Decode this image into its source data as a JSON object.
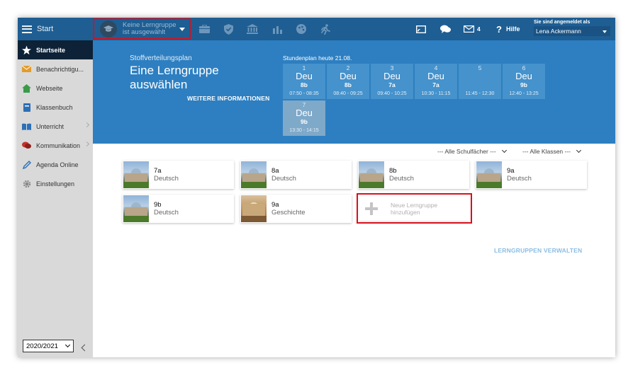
{
  "topbar": {
    "start_label": "Start",
    "group_select_line1": "Keine Lerngruppe",
    "group_select_line2": "ist ausgewählt",
    "icons": [
      "briefcase-icon",
      "shield-icon",
      "institution-icon",
      "bar-chart-icon",
      "palette-icon",
      "running-icon"
    ],
    "mail_count": "4",
    "help_label": "Hilfe",
    "login_label": "Sie sind angemeldet als",
    "login_user": "Lena Ackermann"
  },
  "sidebar": {
    "items": [
      {
        "label": "Startseite",
        "icon": "star-icon",
        "active": true
      },
      {
        "label": "Benachrichtigu...",
        "icon": "envelope-icon"
      },
      {
        "label": "Webseite",
        "icon": "home-icon"
      },
      {
        "label": "Klassenbuch",
        "icon": "book-icon"
      },
      {
        "label": "Unterricht",
        "icon": "open-book-icon",
        "chevron": true
      },
      {
        "label": "Kommunikation",
        "icon": "chat-icon",
        "chevron": true
      },
      {
        "label": "Agenda Online",
        "icon": "pencil-icon"
      },
      {
        "label": "Einstellungen",
        "icon": "gear-icon"
      }
    ],
    "year": "2020/2021"
  },
  "hero": {
    "subtitle": "Stoffverteilungsplan",
    "title": "Eine Lerngruppe auswählen",
    "more_link": "WEITERE INFORMATIONEN",
    "schedule_title": "Stundenplan heute 21.08.",
    "slots": [
      {
        "num": "1",
        "subject": "Deu",
        "class": "8b",
        "time": "07:50 - 08:35"
      },
      {
        "num": "2",
        "subject": "Deu",
        "class": "8b",
        "time": "08:40 - 09:25"
      },
      {
        "num": "3",
        "subject": "Deu",
        "class": "7a",
        "time": "09:40 - 10:25"
      },
      {
        "num": "4",
        "subject": "Deu",
        "class": "7a",
        "time": "10:30 - 11:15"
      },
      {
        "num": "5",
        "subject": "",
        "class": "",
        "time": "11:45 - 12:30"
      },
      {
        "num": "6",
        "subject": "Deu",
        "class": "9b",
        "time": "12:40 - 13:25"
      },
      {
        "num": "7",
        "subject": "Deu",
        "class": "9b",
        "time": "13:30 - 14:15"
      }
    ]
  },
  "filters": {
    "subjects": "--- Alle Schulfächer ---",
    "classes": "--- Alle Klassen ---"
  },
  "groups": [
    {
      "class": "7a",
      "subject": "Deutsch"
    },
    {
      "class": "8a",
      "subject": "Deutsch"
    },
    {
      "class": "8b",
      "subject": "Deutsch"
    },
    {
      "class": "9a",
      "subject": "Deutsch"
    },
    {
      "class": "9b",
      "subject": "Deutsch"
    },
    {
      "class": "9a",
      "subject": "Geschichte"
    }
  ],
  "add_group": {
    "line1": "Neue Lerngruppe",
    "line2": "hinzufügen"
  },
  "manage_link": "LERNGRUPPEN VERWALTEN",
  "colors": {
    "primary": "#1e5e93",
    "hero": "#2d7fc1",
    "highlight": "#d8101d",
    "sidebar_active": "#0d2236"
  }
}
